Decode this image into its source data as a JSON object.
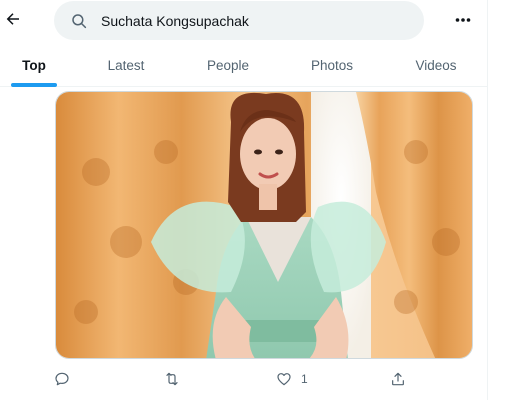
{
  "search": {
    "value": "Suchata Kongsupachak"
  },
  "tabs": [
    {
      "label": "Top",
      "active": true
    },
    {
      "label": "Latest",
      "active": false
    },
    {
      "label": "People",
      "active": false
    },
    {
      "label": "Photos",
      "active": false
    },
    {
      "label": "Videos",
      "active": false
    }
  ],
  "tweet": {
    "actions": {
      "reply_icon": "reply-icon",
      "retweet_icon": "retweet-icon",
      "like_icon": "like-icon",
      "like_count": "1",
      "share_icon": "share-icon"
    }
  },
  "colors": {
    "accent": "#1d9bf0",
    "muted": "#536471",
    "search_bg": "#eff3f4"
  }
}
